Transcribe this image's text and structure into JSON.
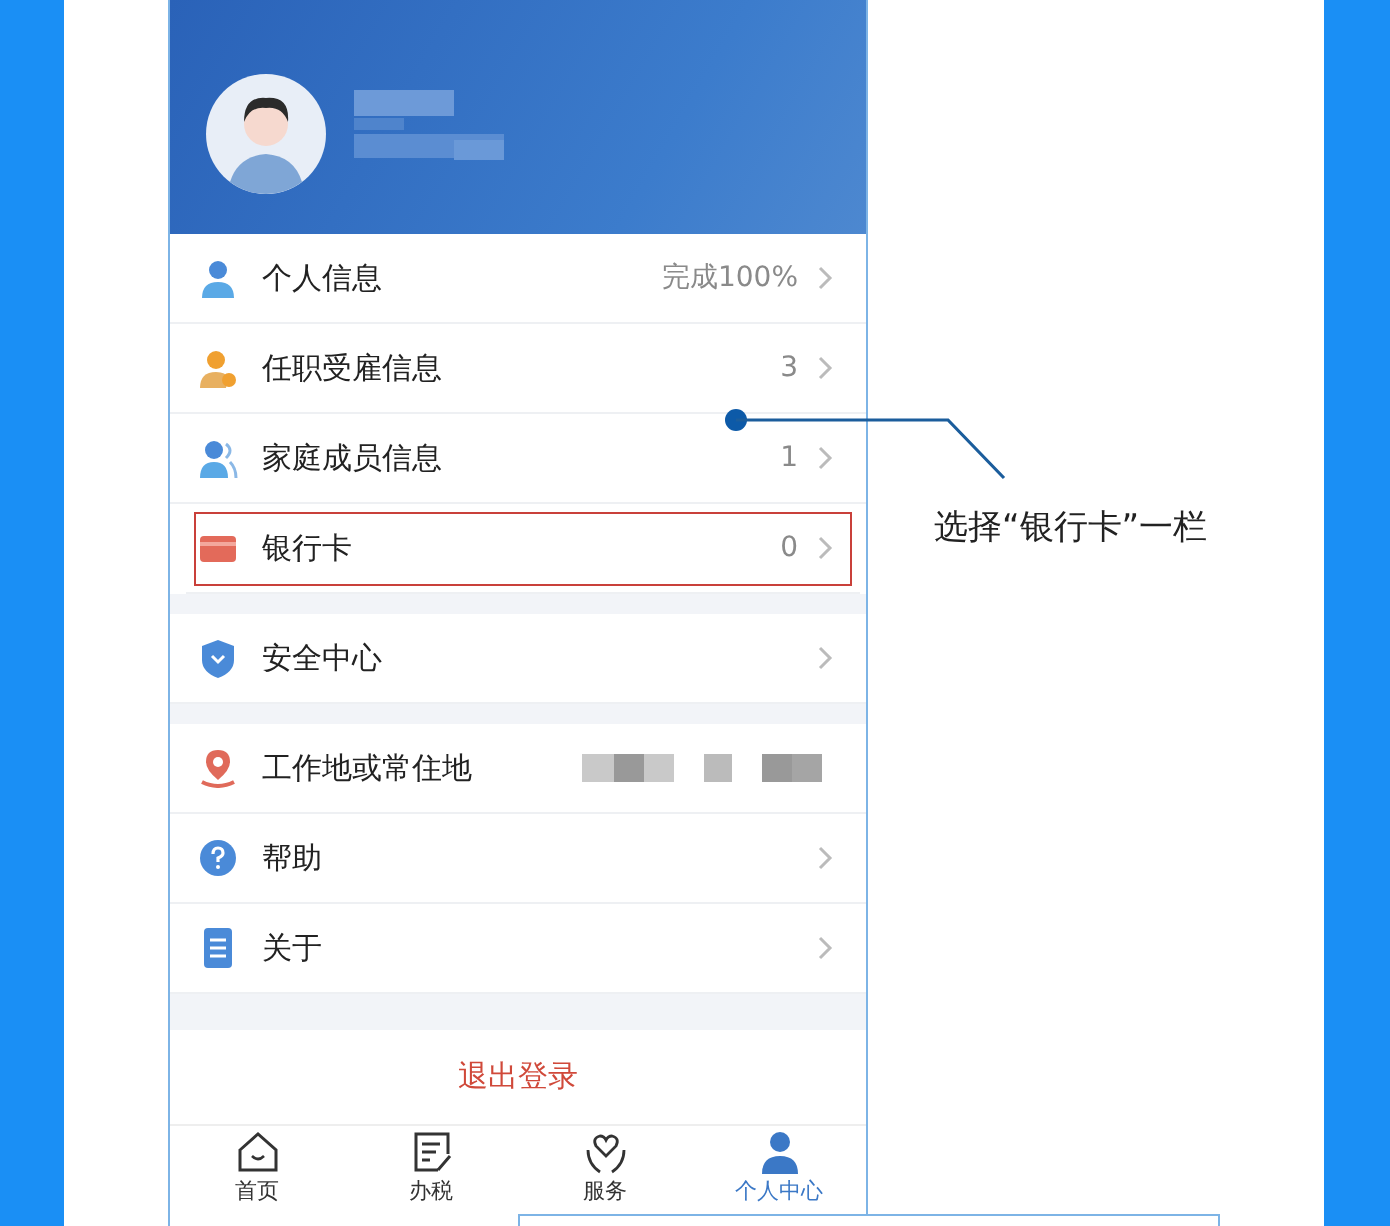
{
  "menu_groups": [
    {
      "rows": [
        {
          "kind": "person",
          "label": "个人信息",
          "value": "完成100%",
          "chevron": true,
          "highlighted": false
        },
        {
          "kind": "employment",
          "label": "任职受雇信息",
          "value": "3",
          "chevron": true,
          "highlighted": false
        },
        {
          "kind": "family",
          "label": "家庭成员信息",
          "value": "1",
          "chevron": true,
          "highlighted": false
        },
        {
          "kind": "card",
          "label": "银行卡",
          "value": "0",
          "chevron": true,
          "highlighted": true
        }
      ]
    },
    {
      "rows": [
        {
          "kind": "shield",
          "label": "安全中心",
          "chevron": true,
          "highlighted": false
        }
      ]
    },
    {
      "rows": [
        {
          "kind": "pin",
          "label": "工作地或常住地",
          "redacted": true,
          "chevron": false,
          "highlighted": false
        },
        {
          "kind": "help",
          "label": "帮助",
          "chevron": true,
          "highlighted": false
        },
        {
          "kind": "doc",
          "label": "关于",
          "chevron": true,
          "highlighted": false
        }
      ]
    }
  ],
  "logout": "退出登录",
  "tabs": [
    {
      "kind": "home",
      "label": "首页",
      "selected": false
    },
    {
      "kind": "tax",
      "label": "办税",
      "selected": false
    },
    {
      "kind": "service",
      "label": "服务",
      "selected": false
    },
    {
      "kind": "user",
      "label": "个人中心",
      "selected": true
    }
  ],
  "annotation": "选择“银行卡”一栏"
}
